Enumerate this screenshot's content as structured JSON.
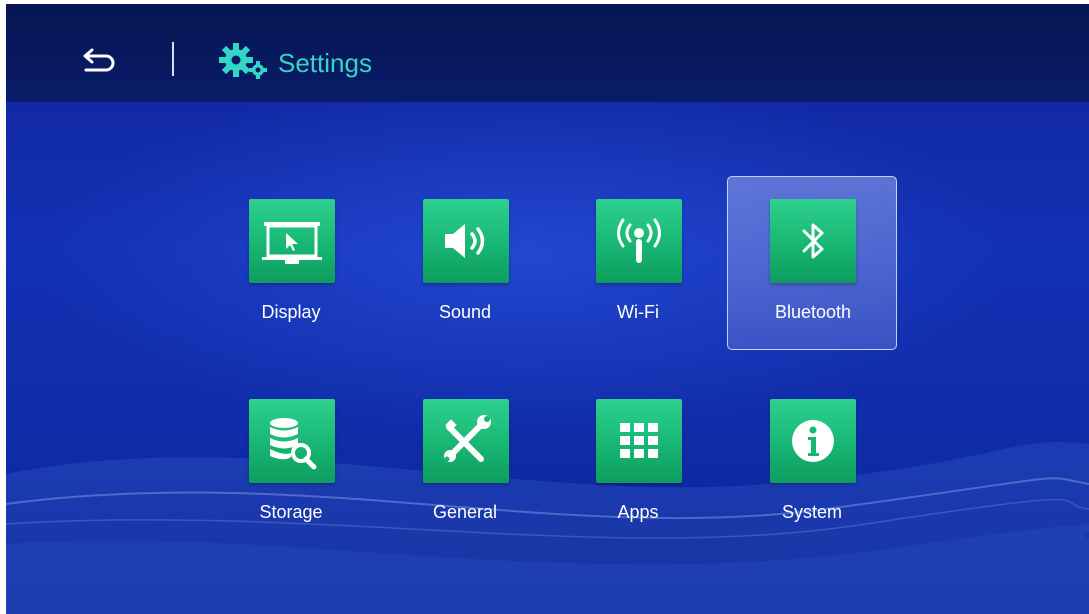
{
  "header": {
    "title": "Settings",
    "back_icon": "back-arrow-icon",
    "settings_icon": "gears-icon"
  },
  "tiles": [
    {
      "label": "Display",
      "icon": "projector-screen-icon"
    },
    {
      "label": "Sound",
      "icon": "speaker-icon"
    },
    {
      "label": "Wi-Fi",
      "icon": "wifi-antenna-icon"
    },
    {
      "label": "Bluetooth",
      "icon": "bluetooth-icon",
      "selected": true
    },
    {
      "label": "Storage",
      "icon": "database-search-icon"
    },
    {
      "label": "General",
      "icon": "tools-icon"
    },
    {
      "label": "Apps",
      "icon": "apps-grid-icon"
    },
    {
      "label": "System",
      "icon": "info-icon"
    }
  ],
  "colors": {
    "accent": "#33d6c4",
    "tile_green": "#17b673",
    "background": "#1430b4",
    "header": "#0a1c6a"
  }
}
